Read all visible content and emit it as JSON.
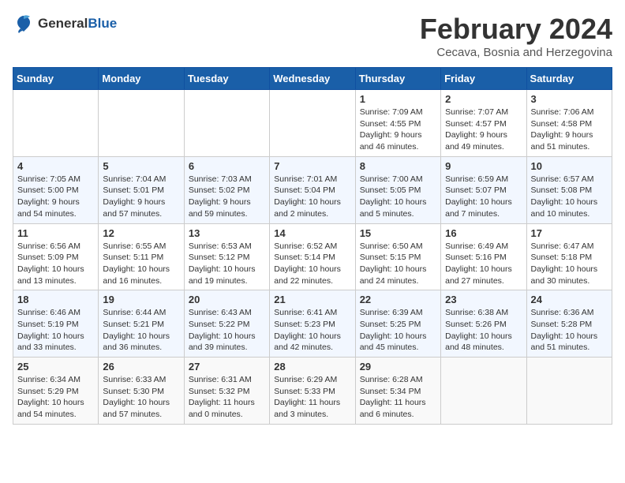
{
  "header": {
    "logo_general": "General",
    "logo_blue": "Blue",
    "month_title": "February 2024",
    "location": "Cecava, Bosnia and Herzegovina"
  },
  "weekdays": [
    "Sunday",
    "Monday",
    "Tuesday",
    "Wednesday",
    "Thursday",
    "Friday",
    "Saturday"
  ],
  "weeks": [
    [
      {
        "day": "",
        "info": ""
      },
      {
        "day": "",
        "info": ""
      },
      {
        "day": "",
        "info": ""
      },
      {
        "day": "",
        "info": ""
      },
      {
        "day": "1",
        "info": "Sunrise: 7:09 AM\nSunset: 4:55 PM\nDaylight: 9 hours\nand 46 minutes."
      },
      {
        "day": "2",
        "info": "Sunrise: 7:07 AM\nSunset: 4:57 PM\nDaylight: 9 hours\nand 49 minutes."
      },
      {
        "day": "3",
        "info": "Sunrise: 7:06 AM\nSunset: 4:58 PM\nDaylight: 9 hours\nand 51 minutes."
      }
    ],
    [
      {
        "day": "4",
        "info": "Sunrise: 7:05 AM\nSunset: 5:00 PM\nDaylight: 9 hours\nand 54 minutes."
      },
      {
        "day": "5",
        "info": "Sunrise: 7:04 AM\nSunset: 5:01 PM\nDaylight: 9 hours\nand 57 minutes."
      },
      {
        "day": "6",
        "info": "Sunrise: 7:03 AM\nSunset: 5:02 PM\nDaylight: 9 hours\nand 59 minutes."
      },
      {
        "day": "7",
        "info": "Sunrise: 7:01 AM\nSunset: 5:04 PM\nDaylight: 10 hours\nand 2 minutes."
      },
      {
        "day": "8",
        "info": "Sunrise: 7:00 AM\nSunset: 5:05 PM\nDaylight: 10 hours\nand 5 minutes."
      },
      {
        "day": "9",
        "info": "Sunrise: 6:59 AM\nSunset: 5:07 PM\nDaylight: 10 hours\nand 7 minutes."
      },
      {
        "day": "10",
        "info": "Sunrise: 6:57 AM\nSunset: 5:08 PM\nDaylight: 10 hours\nand 10 minutes."
      }
    ],
    [
      {
        "day": "11",
        "info": "Sunrise: 6:56 AM\nSunset: 5:09 PM\nDaylight: 10 hours\nand 13 minutes."
      },
      {
        "day": "12",
        "info": "Sunrise: 6:55 AM\nSunset: 5:11 PM\nDaylight: 10 hours\nand 16 minutes."
      },
      {
        "day": "13",
        "info": "Sunrise: 6:53 AM\nSunset: 5:12 PM\nDaylight: 10 hours\nand 19 minutes."
      },
      {
        "day": "14",
        "info": "Sunrise: 6:52 AM\nSunset: 5:14 PM\nDaylight: 10 hours\nand 22 minutes."
      },
      {
        "day": "15",
        "info": "Sunrise: 6:50 AM\nSunset: 5:15 PM\nDaylight: 10 hours\nand 24 minutes."
      },
      {
        "day": "16",
        "info": "Sunrise: 6:49 AM\nSunset: 5:16 PM\nDaylight: 10 hours\nand 27 minutes."
      },
      {
        "day": "17",
        "info": "Sunrise: 6:47 AM\nSunset: 5:18 PM\nDaylight: 10 hours\nand 30 minutes."
      }
    ],
    [
      {
        "day": "18",
        "info": "Sunrise: 6:46 AM\nSunset: 5:19 PM\nDaylight: 10 hours\nand 33 minutes."
      },
      {
        "day": "19",
        "info": "Sunrise: 6:44 AM\nSunset: 5:21 PM\nDaylight: 10 hours\nand 36 minutes."
      },
      {
        "day": "20",
        "info": "Sunrise: 6:43 AM\nSunset: 5:22 PM\nDaylight: 10 hours\nand 39 minutes."
      },
      {
        "day": "21",
        "info": "Sunrise: 6:41 AM\nSunset: 5:23 PM\nDaylight: 10 hours\nand 42 minutes."
      },
      {
        "day": "22",
        "info": "Sunrise: 6:39 AM\nSunset: 5:25 PM\nDaylight: 10 hours\nand 45 minutes."
      },
      {
        "day": "23",
        "info": "Sunrise: 6:38 AM\nSunset: 5:26 PM\nDaylight: 10 hours\nand 48 minutes."
      },
      {
        "day": "24",
        "info": "Sunrise: 6:36 AM\nSunset: 5:28 PM\nDaylight: 10 hours\nand 51 minutes."
      }
    ],
    [
      {
        "day": "25",
        "info": "Sunrise: 6:34 AM\nSunset: 5:29 PM\nDaylight: 10 hours\nand 54 minutes."
      },
      {
        "day": "26",
        "info": "Sunrise: 6:33 AM\nSunset: 5:30 PM\nDaylight: 10 hours\nand 57 minutes."
      },
      {
        "day": "27",
        "info": "Sunrise: 6:31 AM\nSunset: 5:32 PM\nDaylight: 11 hours\nand 0 minutes."
      },
      {
        "day": "28",
        "info": "Sunrise: 6:29 AM\nSunset: 5:33 PM\nDaylight: 11 hours\nand 3 minutes."
      },
      {
        "day": "29",
        "info": "Sunrise: 6:28 AM\nSunset: 5:34 PM\nDaylight: 11 hours\nand 6 minutes."
      },
      {
        "day": "",
        "info": ""
      },
      {
        "day": "",
        "info": ""
      }
    ]
  ]
}
